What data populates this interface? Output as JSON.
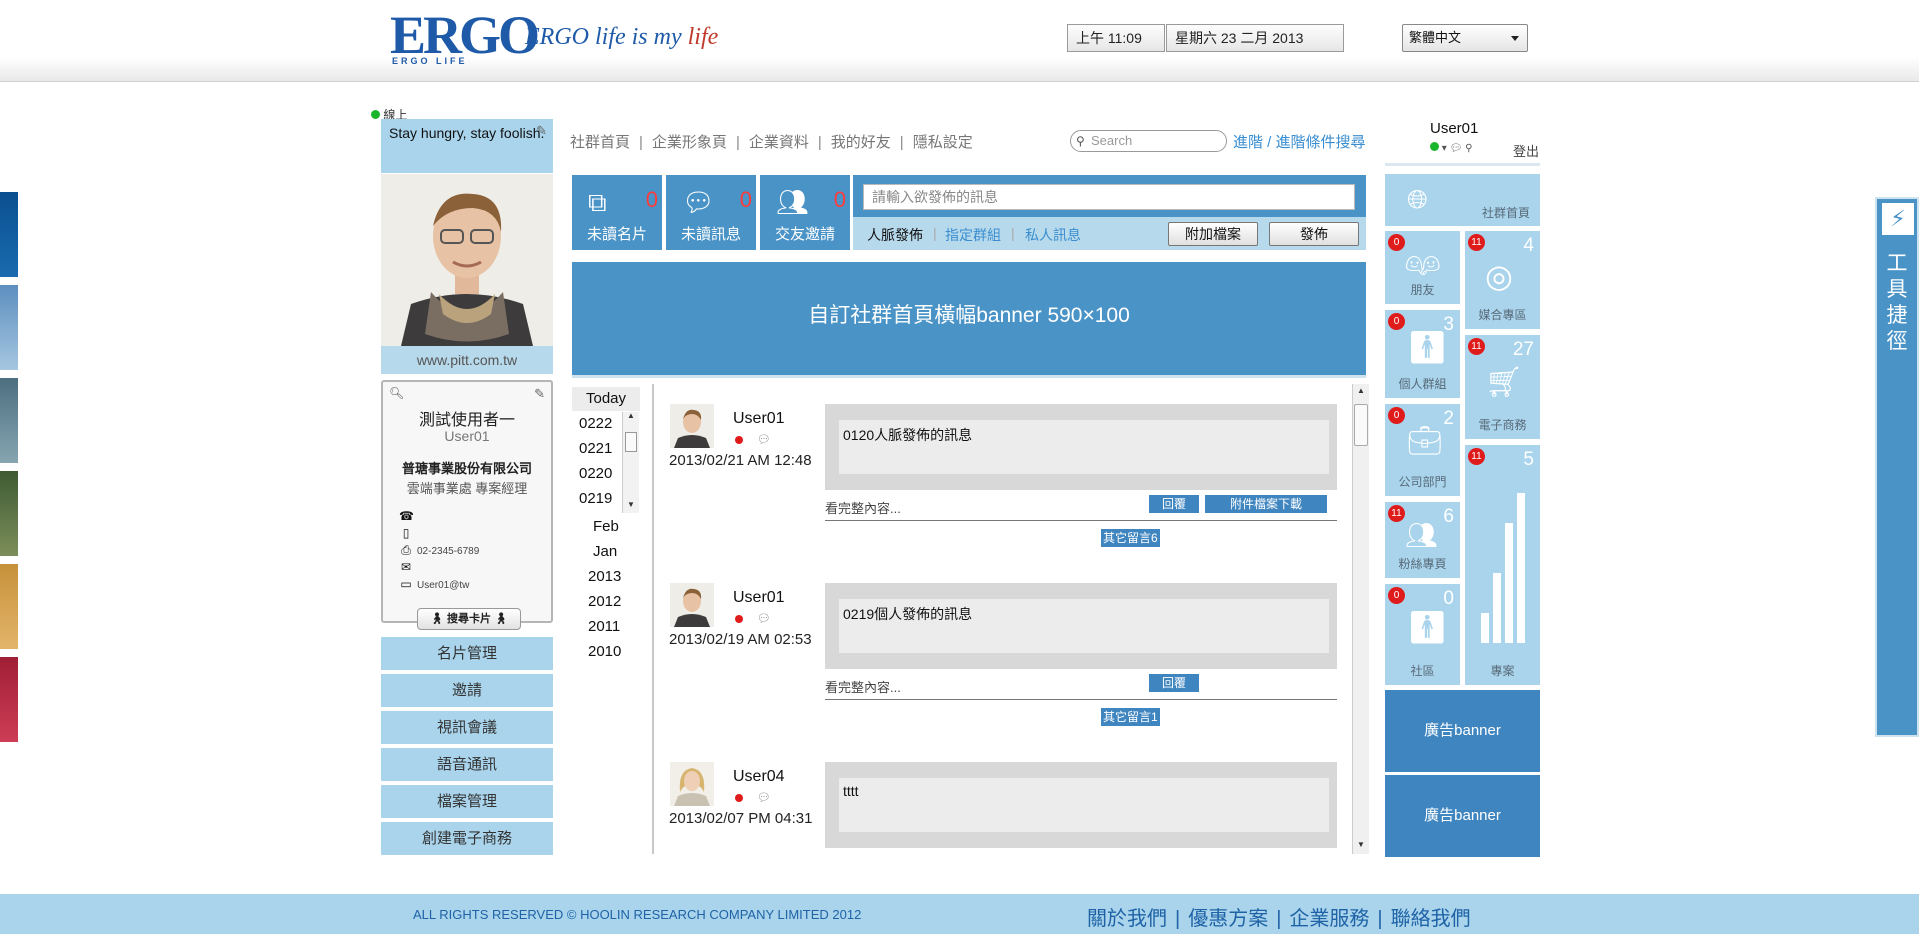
{
  "header": {
    "logo_text": "ERGO",
    "logo_sub": "ERGO LIFE",
    "slogan_main": "ERGO life is my ",
    "slogan_life": "life",
    "time": "上午 11:09",
    "date": "星期六 23 二月 2013",
    "language": "繁體中文"
  },
  "profile": {
    "status_label": "線上",
    "motto": "Stay hungry, stay foolish.",
    "site_url": "www.pitt.com.tw",
    "card_name": "測試使用者一",
    "card_user": "User01",
    "company": "普瑭事業股份有限公司",
    "department": "雲端事業處 專案經理",
    "fax": "02-2345-6789",
    "web": "User01@tw",
    "card_button": "搜尋卡片"
  },
  "left_nav": [
    "名片管理",
    "邀請",
    "視訊會議",
    "語音通訊",
    "檔案管理",
    "創建電子商務"
  ],
  "top_links": [
    "社群首頁",
    "企業形象頁",
    "企業資料",
    "我的好友",
    "隱私設定"
  ],
  "search": {
    "placeholder": "Search",
    "advanced": "進階 / 進階條件搜尋"
  },
  "stats": [
    {
      "label": "未讀名片",
      "count": "0",
      "icon": "card-icon"
    },
    {
      "label": "未讀訊息",
      "count": "0",
      "icon": "message-icon"
    },
    {
      "label": "交友邀請",
      "count": "0",
      "icon": "friends-icon"
    }
  ],
  "post_panel": {
    "placeholder": "請輸入欲發佈的訊息",
    "tab_1": "人脈發佈",
    "tab_2": "指定群組",
    "tab_3": "私人訊息",
    "attach": "附加檔案",
    "publish": "發佈"
  },
  "banner_text": "自訂社群首頁橫幅banner 590×100",
  "dates": {
    "today": "Today",
    "days": [
      "0222",
      "0221",
      "0220",
      "0219"
    ],
    "months": [
      "Feb",
      "Jan"
    ],
    "years": [
      "2013",
      "2012",
      "2011",
      "2010"
    ]
  },
  "feed": [
    {
      "user": "User01",
      "time": "2013/02/21 AM 12:48",
      "message": "0120人脈發佈的訊息",
      "more": "看完整內容...",
      "reply": "回覆",
      "download": "附件檔案下載",
      "others": "其它留言6"
    },
    {
      "user": "User01",
      "time": "2013/02/19 AM 02:53",
      "message": "0219個人發佈的訊息",
      "more": "看完整內容...",
      "reply": "回覆",
      "others": "其它留言1"
    },
    {
      "user": "User04",
      "time": "2013/02/07 PM 04:31",
      "message": "tttt"
    }
  ],
  "right_panel": {
    "user": "User01",
    "logout": "登出",
    "home_tile": "社群首頁",
    "tiles": [
      {
        "label": "朋友",
        "badge": "0",
        "count": ""
      },
      {
        "label": "媒合專區",
        "badge": "11",
        "count": "4"
      },
      {
        "label": "個人群組",
        "badge": "0",
        "count": "3"
      },
      {
        "label": "電子商務",
        "badge": "11",
        "count": "27"
      },
      {
        "label": "公司部門",
        "badge": "0",
        "count": "2"
      },
      {
        "label": "專案",
        "badge": "11",
        "count": "5"
      },
      {
        "label": "粉絲專頁",
        "badge": "11",
        "count": "6"
      },
      {
        "label": "社區",
        "badge": "0",
        "count": "0"
      }
    ],
    "ad_1": "廣告banner",
    "ad_2": "廣告banner"
  },
  "toolbar_label": "工具捷徑",
  "footer": {
    "copyright": "ALL RIGHTS RESERVED © HOOLIN RESEARCH COMPANY LIMITED 2012",
    "links": [
      "關於我們",
      "優惠方案",
      "企業服務",
      "聯絡我們"
    ]
  },
  "colors": {
    "accent": "#4a93c7",
    "light_accent": "#a9d4ec",
    "badge_red": "#e01b1b"
  }
}
